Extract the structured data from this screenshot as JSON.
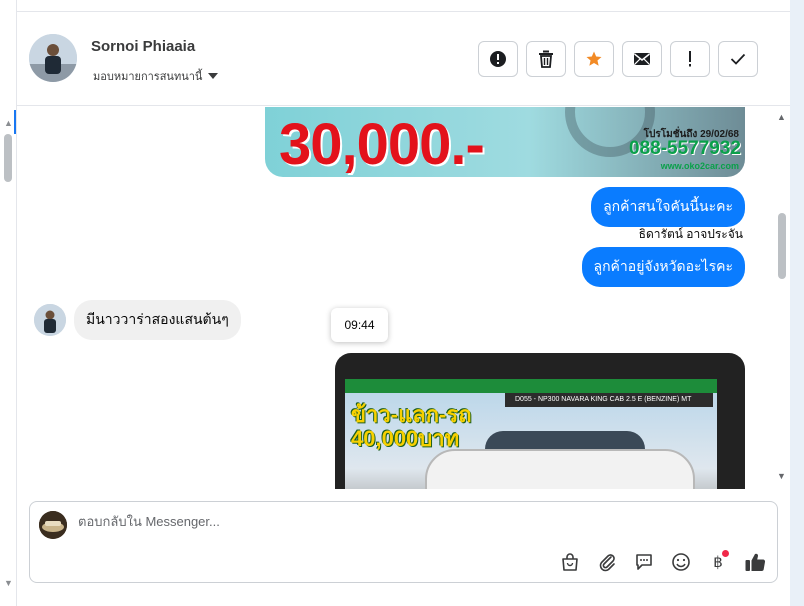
{
  "header": {
    "contact_name": "Sornoi Phiaaia",
    "assign_label": "มอบหมายการสนทนานี้",
    "actions": [
      {
        "name": "report-button",
        "icon": "alert-circle-icon"
      },
      {
        "name": "delete-button",
        "icon": "trash-icon"
      },
      {
        "name": "star-button",
        "icon": "star-icon"
      },
      {
        "name": "mark-unread-button",
        "icon": "envelope-icon"
      },
      {
        "name": "spam-button",
        "icon": "exclamation-icon"
      },
      {
        "name": "done-button",
        "icon": "checkmark-icon"
      }
    ]
  },
  "chat": {
    "promo_image": {
      "price": "30,000.-",
      "date_text": "โปรโมชั่นถึง 29/02/68",
      "phone": "088-5577932",
      "website": "www.oko2car.com"
    },
    "outgoing": [
      {
        "text": "ลูกค้าสนใจคันนี้นะคะ"
      },
      {
        "text": "ลูกค้าอยู่จังหวัดอะไรคะ"
      }
    ],
    "sender_label": "ธิดารัตน์ อาจประจัน",
    "incoming": {
      "text": "มีนาววาร่าสองแสนต้นๆ"
    },
    "timestamp": "09:44",
    "car_image": {
      "model": "D055 - NP300 NAVARA KING CAB 2.5 E (BENZINE) MT",
      "promo_line1": "ข้าว-แลก-รถ",
      "promo_line2": "40,000บาท"
    }
  },
  "composer": {
    "placeholder": "ตอบกลับใน Messenger...",
    "tools": [
      "shopping-bag-icon",
      "paperclip-icon",
      "saved-replies-icon",
      "emoji-icon",
      "baht-payment-icon",
      "thumbs-up-icon"
    ]
  },
  "colors": {
    "outgoing_bubble": "#0a7cff",
    "incoming_bubble": "#f0f0f0",
    "star": "#f28a25",
    "like": "#3a3b3c"
  }
}
